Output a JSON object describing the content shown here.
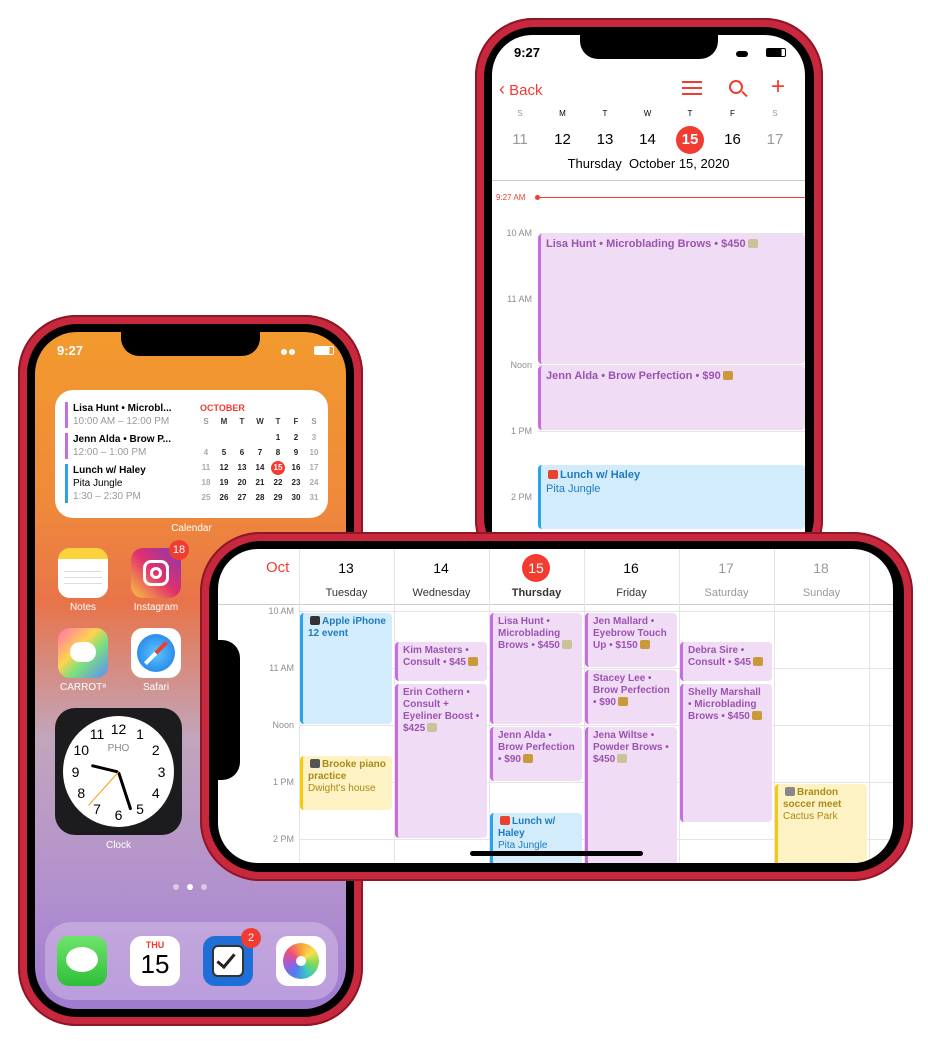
{
  "colors": {
    "frame": "#c8283e",
    "accent": "#f23c32",
    "appointment": "#c46fdc",
    "personal": "#2aa3ee",
    "family": "#f6c90e"
  },
  "portrait_calendar": {
    "status_time": "9:27",
    "back_label": "Back",
    "icons": [
      "list-icon",
      "search-icon",
      "plus-icon"
    ],
    "weekday_letters": [
      "S",
      "M",
      "T",
      "W",
      "T",
      "F",
      "S"
    ],
    "week_days": [
      "11",
      "12",
      "13",
      "14",
      "15",
      "16",
      "17"
    ],
    "selected_index": 4,
    "date_label": "Thursday  October 15, 2020",
    "now_label": "9:27 AM",
    "hour_labels": [
      {
        "label": "10 AM",
        "hour": 10
      },
      {
        "label": "11 AM",
        "hour": 11
      },
      {
        "label": "Noon",
        "hour": 12
      },
      {
        "label": "1 PM",
        "hour": 13
      },
      {
        "label": "2 PM",
        "hour": 14
      }
    ],
    "events": [
      {
        "title": "Lisa Hunt • Microblading Brows • $450",
        "icon": "credit-card",
        "start": 10,
        "end": 12,
        "color": "purple"
      },
      {
        "title": "Jenn Alda • Brow Perfection • $90",
        "icon": "money-bag",
        "start": 12,
        "end": 13,
        "color": "purple"
      },
      {
        "title": "Lunch w/ Haley",
        "location": "Pita Jungle",
        "icon": "fries",
        "icon_before": true,
        "start": 13.5,
        "end": 14.5,
        "color": "blue"
      }
    ]
  },
  "home_screen": {
    "status_time": "9:27",
    "widget": {
      "events": [
        {
          "title": "Lisa Hunt • Microbl...",
          "time": "10:00 AM – 12:00 PM",
          "color": "purple"
        },
        {
          "title": "Jenn Alda • Brow P...",
          "time": "12:00 – 1:00 PM",
          "color": "purple"
        },
        {
          "title": "Lunch w/ Haley",
          "location": "Pita Jungle",
          "time": "1:30 – 2:30 PM",
          "color": "blue"
        }
      ],
      "month": "OCTOBER",
      "weekday_letters": [
        "S",
        "M",
        "T",
        "W",
        "T",
        "F",
        "S"
      ],
      "weeks": [
        [
          "",
          "",
          "",
          "",
          "1",
          "2",
          "3"
        ],
        [
          "4",
          "5",
          "6",
          "7",
          "8",
          "9",
          "10"
        ],
        [
          "11",
          "12",
          "13",
          "14",
          "15",
          "16",
          "17"
        ],
        [
          "18",
          "19",
          "20",
          "21",
          "22",
          "23",
          "24"
        ],
        [
          "25",
          "26",
          "27",
          "28",
          "29",
          "30",
          "31"
        ]
      ],
      "today": "15",
      "label": "Calendar"
    },
    "apps": [
      {
        "label": "Notes"
      },
      {
        "label": "Instagram",
        "badge": "18"
      },
      {
        "label": "CARROTᵃ"
      },
      {
        "label": "Safari"
      }
    ],
    "clock": {
      "city": "PHO",
      "label": "Clock",
      "numbers": [
        "12",
        "1",
        "2",
        "3",
        "4",
        "5",
        "6",
        "7",
        "8",
        "9",
        "10",
        "11"
      ],
      "hour": 9.45,
      "minute": 27,
      "second": 37
    },
    "dock": {
      "calendar_day": "THU",
      "calendar_date": "15",
      "reminders_badge": "2",
      "apps": [
        "messages-icon",
        "calendar-icon",
        "reminders-icon",
        "photos-icon"
      ]
    }
  },
  "landscape_calendar": {
    "month": "Oct",
    "days": [
      {
        "num": "13",
        "name": "Tuesday"
      },
      {
        "num": "14",
        "name": "Wednesday"
      },
      {
        "num": "15",
        "name": "Thursday",
        "today": true
      },
      {
        "num": "16",
        "name": "Friday"
      },
      {
        "num": "17",
        "name": "Saturday",
        "weekend": true
      },
      {
        "num": "18",
        "name": "Sunday",
        "weekend": true
      }
    ],
    "hour_labels": [
      {
        "label": "10 AM",
        "hour": 10
      },
      {
        "label": "11 AM",
        "hour": 11
      },
      {
        "label": "Noon",
        "hour": 12
      },
      {
        "label": "1 PM",
        "hour": 13
      },
      {
        "label": "2 PM",
        "hour": 14
      }
    ],
    "events": [
      {
        "day": 0,
        "title": "Apple iPhone 12 event",
        "icon": "phone",
        "icon_before": true,
        "start": 10,
        "end": 12,
        "color": "blue"
      },
      {
        "day": 0,
        "title": "Brooke piano practice",
        "location": "Dwight's house",
        "icon": "piano",
        "icon_before": true,
        "start": 12.5,
        "end": 13.5,
        "color": "yellow"
      },
      {
        "day": 1,
        "title": "Kim Masters • Consult • $45",
        "icon": "money-bag",
        "start": 10.5,
        "end": 11.25,
        "color": "purple"
      },
      {
        "day": 1,
        "title": "Erin Cothern • Consult + Eyeliner Boost • $425",
        "icon": "credit-card",
        "start": 11.25,
        "end": 14,
        "color": "purple"
      },
      {
        "day": 2,
        "title": "Lisa Hunt • Microblading Brows • $450",
        "icon": "credit-card",
        "start": 10,
        "end": 12,
        "color": "purple"
      },
      {
        "day": 2,
        "title": "Jenn Alda • Brow Perfection • $90",
        "icon": "money-bag",
        "start": 12,
        "end": 13,
        "color": "purple"
      },
      {
        "day": 2,
        "title": "Lunch w/ Haley",
        "location": "Pita Jungle",
        "icon": "fries",
        "icon_before": true,
        "start": 13.5,
        "end": 14.5,
        "color": "blue"
      },
      {
        "day": 3,
        "title": "Jen Mallard • Eyebrow Touch Up • $150",
        "icon": "money-bag",
        "start": 10,
        "end": 11,
        "color": "purple"
      },
      {
        "day": 3,
        "title": "Stacey Lee • Brow Perfection • $90",
        "icon": "money-bag",
        "start": 11,
        "end": 12,
        "color": "purple"
      },
      {
        "day": 3,
        "title": "Jena Wiltse • Powder Brows • $450",
        "icon": "credit-card",
        "start": 12,
        "end": 14.5,
        "color": "purple"
      },
      {
        "day": 4,
        "title": "Debra Sire • Consult • $45",
        "icon": "money-bag",
        "start": 10.5,
        "end": 11.25,
        "color": "purple"
      },
      {
        "day": 4,
        "title": "Shelly Marshall • Microblading Brows • $450",
        "icon": "money-bag",
        "start": 11.25,
        "end": 13.72,
        "color": "purple"
      },
      {
        "day": 5,
        "title": "Brandon soccer meet",
        "location": "Cactus Park",
        "icon": "soccer-ball",
        "icon_before": true,
        "start": 13,
        "end": 14.5,
        "color": "yellow"
      }
    ]
  }
}
